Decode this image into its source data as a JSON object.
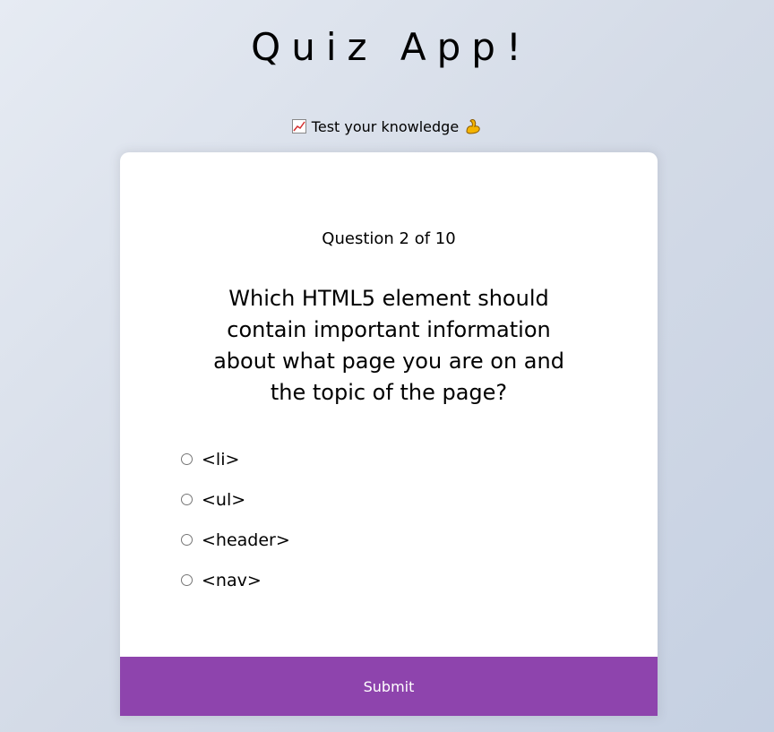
{
  "header": {
    "title": "Quiz App!",
    "subtitle": "Test your knowledge",
    "subtitle_leading_icon": "chart-increasing-icon",
    "subtitle_trailing_icon": "flexed-biceps-icon"
  },
  "quiz": {
    "question_count": "Question 2 of 10",
    "question": "Which HTML5 element should contain important information about what page you are on and the topic of the page?",
    "answers": [
      {
        "label": "<li>"
      },
      {
        "label": "<ul>"
      },
      {
        "label": "<header>"
      },
      {
        "label": "<nav>"
      }
    ],
    "submit_label": "Submit"
  },
  "colors": {
    "accent": "#8e44ad",
    "card": "#ffffff"
  }
}
